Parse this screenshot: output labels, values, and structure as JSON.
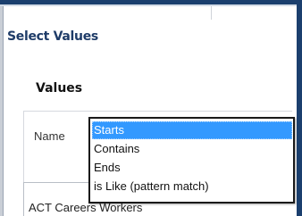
{
  "dialog": {
    "title": "Select Values",
    "section_title": "Values"
  },
  "filter": {
    "field_label": "Name",
    "options": [
      "Starts",
      "Contains",
      "Ends",
      "is Like (pattern match)"
    ],
    "selected_option": "Starts"
  },
  "values_list": {
    "partial_item": "ACT Careers Workers"
  },
  "colors": {
    "title_text": "#1f3c68",
    "window_frame": "#1b3f6e",
    "selection_highlight": "#3399ff"
  }
}
